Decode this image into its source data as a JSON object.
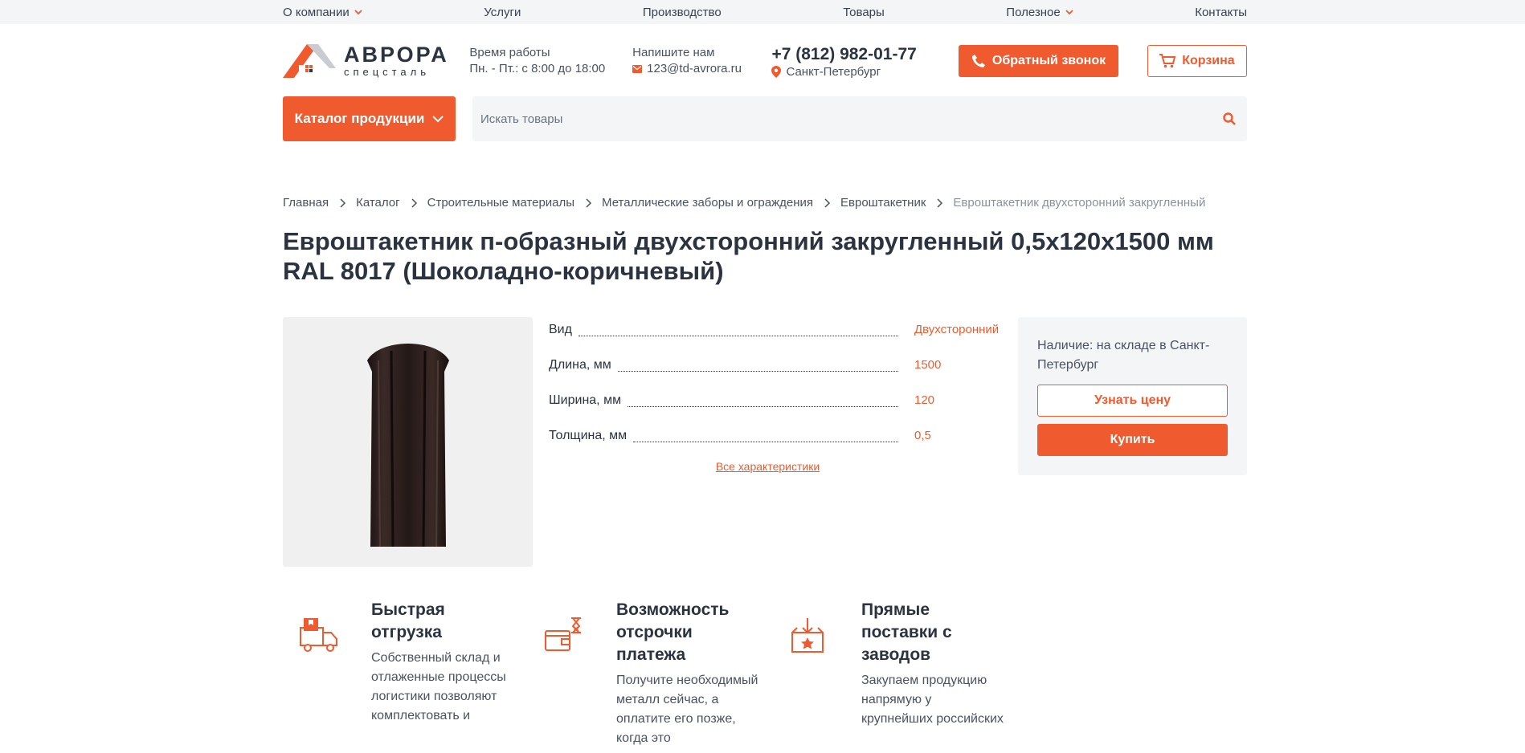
{
  "topnav": {
    "company": "О компании",
    "services": "Услуги",
    "production": "Производство",
    "goods": "Товары",
    "useful": "Полезное",
    "contacts": "Контакты"
  },
  "logo": {
    "name": "АВРОРА",
    "sub": "спецсталь"
  },
  "header": {
    "hours_label": "Время работы",
    "hours_value": "Пн. - Пт.: с 8:00 до 18:00",
    "mail_label": "Напишите нам",
    "mail_value": "123@td-avrora.ru",
    "phone": "+7 (812) 982-01-77",
    "city": "Санкт-Петербург",
    "callback_label": "Обратный звонок",
    "cart_label": "Корзина"
  },
  "nav": {
    "catalog_label": "Каталог продукции",
    "search_placeholder": "Искать товары"
  },
  "breadcrumbs": [
    "Главная",
    "Каталог",
    "Строительные материалы",
    "Металлические заборы и ограждения",
    "Евроштакетник",
    "Евроштакетник двухсторонний закругленный"
  ],
  "product": {
    "title": "Евроштакетник п-образный двухсторонний закругленный 0,5х120х1500 мм RAL 8017 (Шоколадно-коричневый)",
    "specs": [
      {
        "label": "Вид",
        "value": "Двухсторонний"
      },
      {
        "label": "Длина, мм",
        "value": "1500"
      },
      {
        "label": "Ширина, мм",
        "value": "120"
      },
      {
        "label": "Толщина, мм",
        "value": "0,5"
      }
    ],
    "all_specs_label": "Все характеристики",
    "availability": "Наличие: на складе в Санкт-Петербург",
    "price_btn": "Узнать цену",
    "buy_btn": "Купить"
  },
  "features": [
    {
      "icon": "delivery-truck-icon",
      "title": "Быстрая отгрузка",
      "desc": "Собственный склад и отлаженные процессы логистики позволяют комплектовать и"
    },
    {
      "icon": "wallet-hourglass-icon",
      "title": "Возможность отсрочки платежа",
      "desc": "Получите необходимый металл сейчас, а оплатите его позже, когда это"
    },
    {
      "icon": "box-star-icon",
      "title": "Прямые поставки с заводов",
      "desc": "Закупаем продукцию напрямую у крупнейших российских"
    }
  ],
  "colors": {
    "accent": "#f05a2f",
    "text": "#2b3340",
    "muted_bg": "#f4f5f7"
  }
}
